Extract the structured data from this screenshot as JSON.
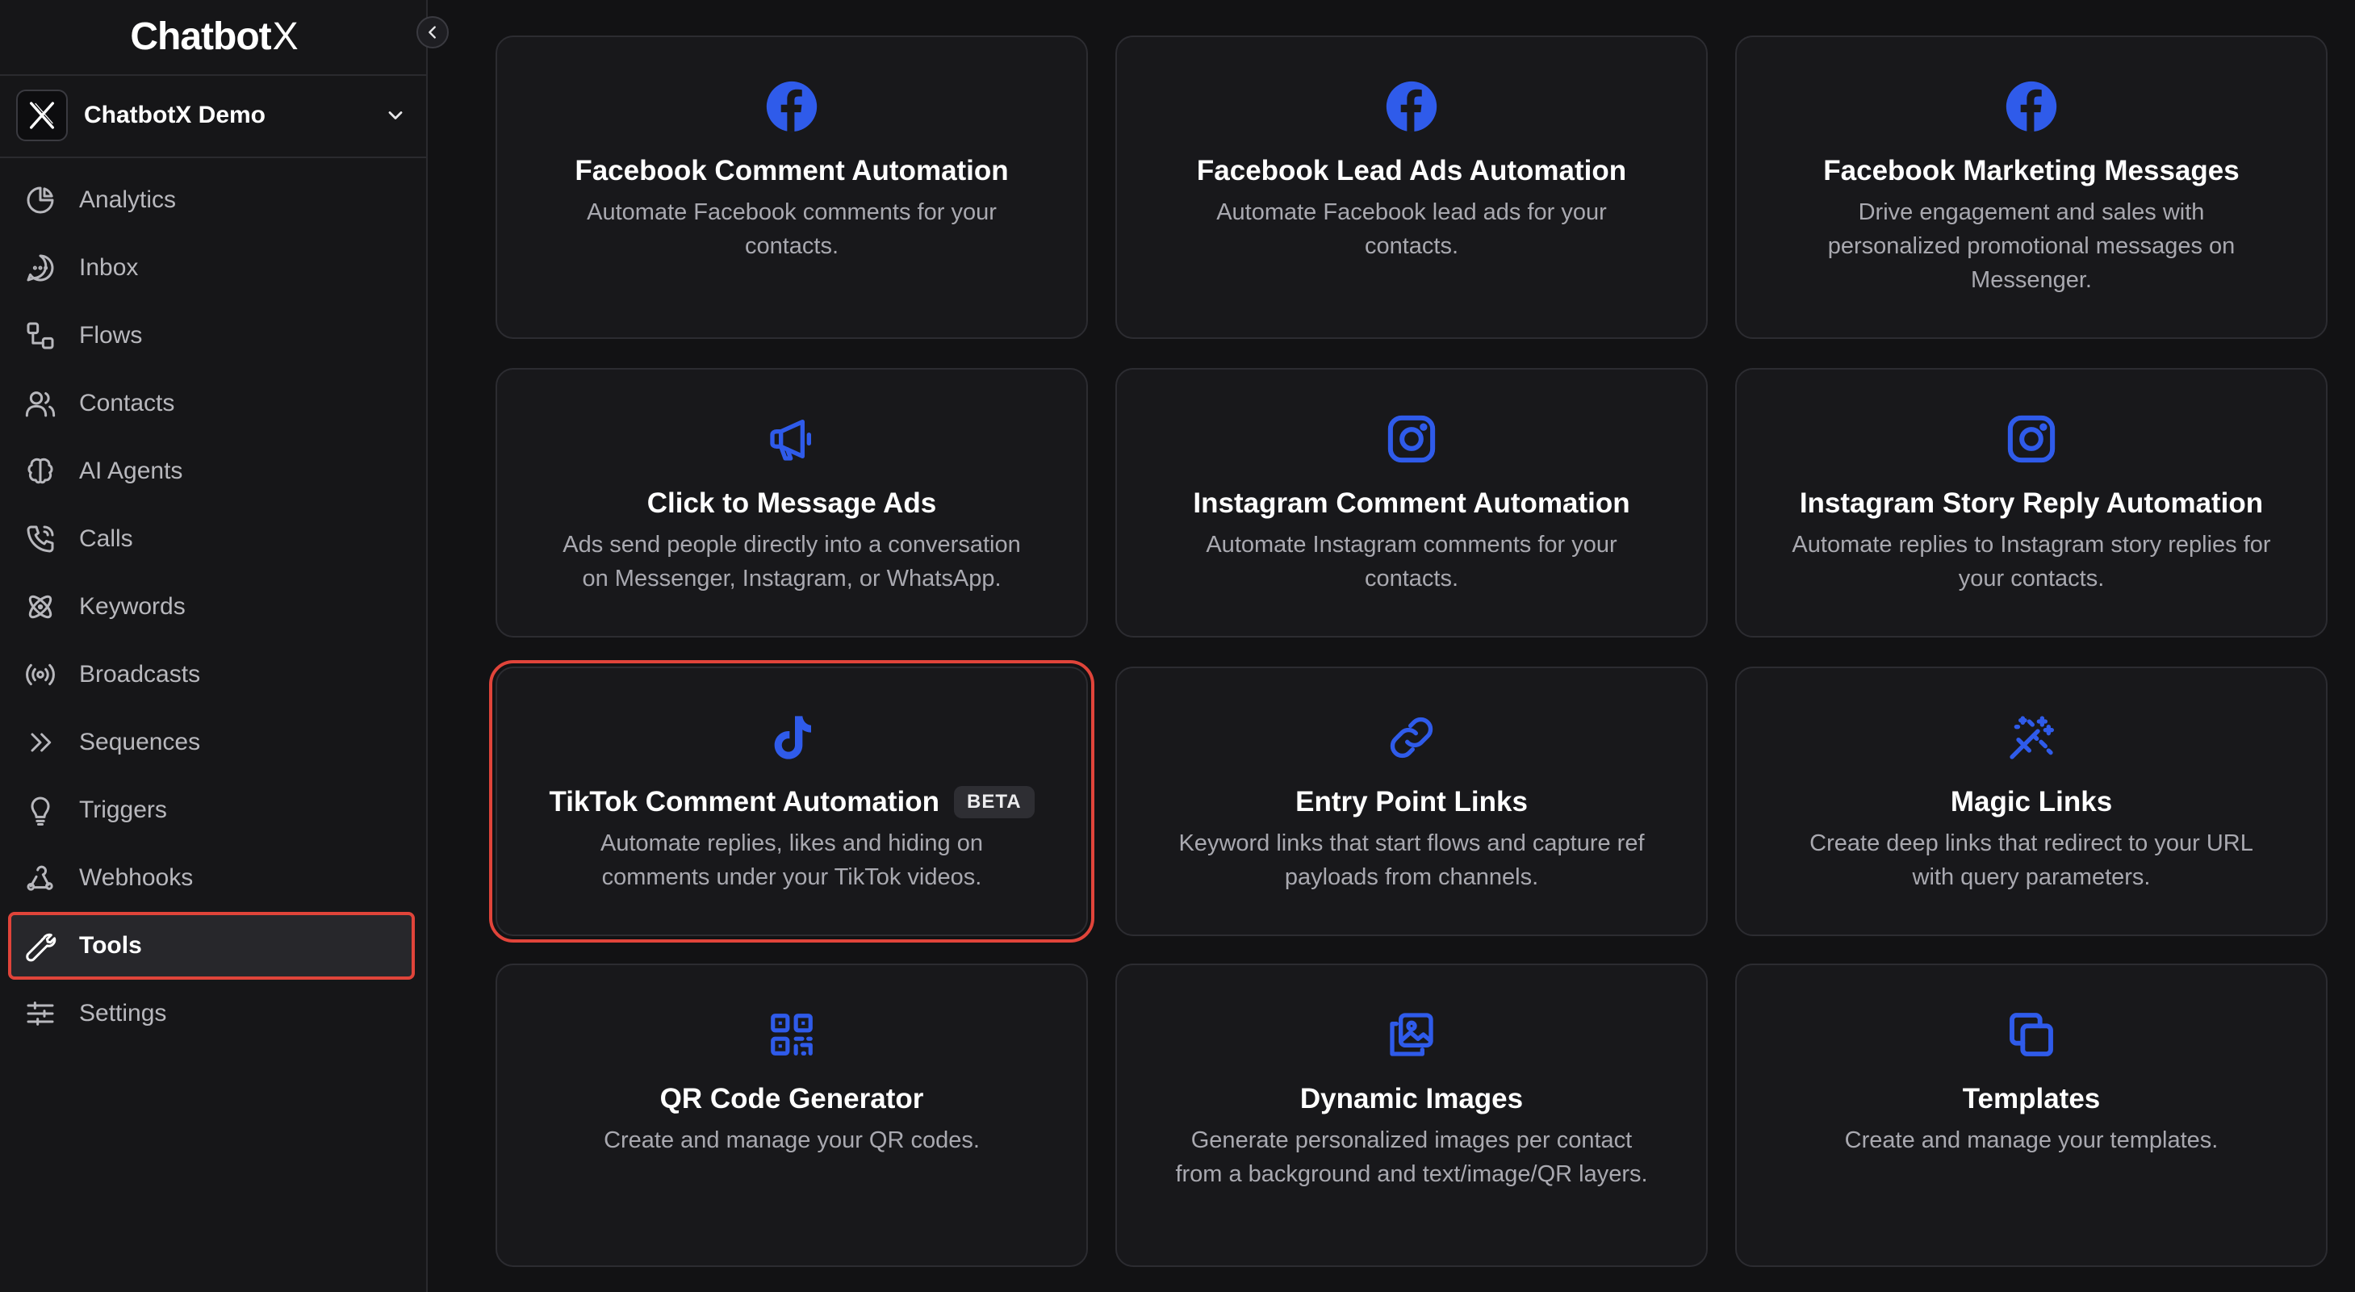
{
  "app": {
    "logo_text": "Chatbot",
    "logo_x": "X"
  },
  "workspace": {
    "name": "ChatbotX Demo"
  },
  "sidebar": {
    "items": [
      {
        "label": "Analytics",
        "icon": "pie-chart-icon"
      },
      {
        "label": "Inbox",
        "icon": "chat-bubble-icon"
      },
      {
        "label": "Flows",
        "icon": "flow-icon"
      },
      {
        "label": "Contacts",
        "icon": "users-icon"
      },
      {
        "label": "AI Agents",
        "icon": "brain-icon"
      },
      {
        "label": "Calls",
        "icon": "phone-icon"
      },
      {
        "label": "Keywords",
        "icon": "atom-icon"
      },
      {
        "label": "Broadcasts",
        "icon": "broadcast-icon"
      },
      {
        "label": "Sequences",
        "icon": "chevrons-right-icon"
      },
      {
        "label": "Triggers",
        "icon": "lightbulb-icon"
      },
      {
        "label": "Webhooks",
        "icon": "webhook-icon"
      },
      {
        "label": "Tools",
        "icon": "wrench-icon",
        "active": true
      },
      {
        "label": "Settings",
        "icon": "sliders-icon"
      }
    ]
  },
  "tools": [
    {
      "title": "Facebook Comment Automation",
      "desc": "Automate Facebook comments for your contacts.",
      "icon": "facebook-icon"
    },
    {
      "title": "Facebook Lead Ads Automation",
      "desc": "Automate Facebook lead ads for your contacts.",
      "icon": "facebook-icon"
    },
    {
      "title": "Facebook Marketing Messages",
      "desc": "Drive engagement and sales with personalized promotional messages on Messenger.",
      "icon": "facebook-icon"
    },
    {
      "title": "Click to Message Ads",
      "desc": "Ads send people directly into a conversation on Messenger, Instagram, or WhatsApp.",
      "icon": "megaphone-icon"
    },
    {
      "title": "Instagram Comment Automation",
      "desc": "Automate Instagram comments for your contacts.",
      "icon": "instagram-icon"
    },
    {
      "title": "Instagram Story Reply Automation",
      "desc": "Automate replies to Instagram story replies for your contacts.",
      "icon": "instagram-icon"
    },
    {
      "title": "TikTok Comment Automation",
      "badge": "BETA",
      "desc": "Automate replies, likes and hiding on comments under your TikTok videos.",
      "icon": "tiktok-icon"
    },
    {
      "title": "Entry Point Links",
      "desc": "Keyword links that start flows and capture ref payloads from channels.",
      "icon": "link-icon"
    },
    {
      "title": "Magic Links",
      "desc": "Create deep links that redirect to your URL with query parameters.",
      "icon": "magic-wand-icon"
    },
    {
      "title": "QR Code Generator",
      "desc": "Create and manage your QR codes.",
      "icon": "qr-code-icon"
    },
    {
      "title": "Dynamic Images",
      "desc": "Generate personalized images per contact from a background and text/image/QR layers.",
      "icon": "image-icon"
    },
    {
      "title": "Templates",
      "desc": "Create and manage your templates.",
      "icon": "copy-icon"
    }
  ],
  "colors": {
    "accent": "#2f5bea",
    "highlight": "#e0443a",
    "background": "#121214"
  }
}
